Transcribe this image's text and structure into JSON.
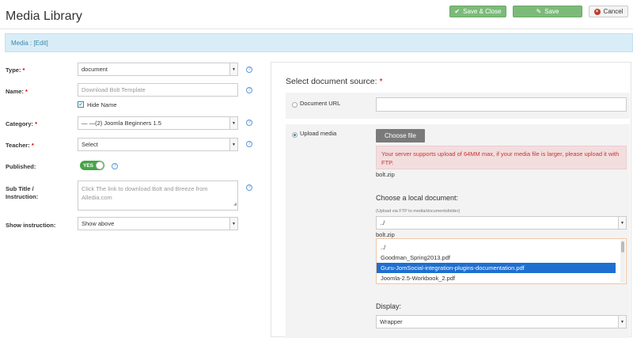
{
  "header": {
    "title": "Media Library",
    "save_close_label": "Save & Close",
    "save_label": "Save",
    "cancel_label": "Cancel"
  },
  "subbar": {
    "text": "Media : [Edit]"
  },
  "form": {
    "type": {
      "label": "Type:",
      "value": "document"
    },
    "name": {
      "label": "Name:",
      "placeholder": "Download Bolt Template"
    },
    "hide_name": {
      "label": "Hide Name",
      "checked": true
    },
    "category": {
      "label": "Category:",
      "value": "— —(2) Joomla Beginners 1.5"
    },
    "teacher": {
      "label": "Teacher:",
      "value": "Select"
    },
    "published": {
      "label": "Published:",
      "value": "YES"
    },
    "subtitle": {
      "label_line1": "Sub Title /",
      "label_line2": "Instruction:",
      "placeholder": "Click The link to download Bolt and Breeze from Alledia.com"
    },
    "show_instruction": {
      "label": "Show instruction:",
      "value": "Show above"
    },
    "required_mark": "*",
    "help_glyph": "?"
  },
  "source": {
    "title": "Select document source:",
    "required_mark": "*",
    "document_url_label": "Document URL",
    "upload_media_label": "Upload media",
    "choose_file_label": "Choose file",
    "alert_text": "Your server supports upload of 64MM max, if your media file is larger, please upload it with FTP.",
    "uploaded_file": "bolt.zip",
    "choose_local_label": "Choose a local document:",
    "ftp_hint": "(Upload via FTP to media/documentsfolder)",
    "folder_value": "../",
    "selected_file": "bolt.zip",
    "files": [
      {
        "name": "../",
        "selected": false
      },
      {
        "name": "Goodman_Spring2013.pdf",
        "selected": false
      },
      {
        "name": "Guru-JomSocial-integration-plugins-documentation.pdf",
        "selected": true
      },
      {
        "name": "Joomla-2.5-Workbook_2.pdf",
        "selected": false
      }
    ],
    "display_label": "Display:",
    "display_value": "Wrapper"
  },
  "colors": {
    "save_green": "#7cba7a",
    "info_bar": "#d9edf7",
    "toggle_green": "#46a546",
    "alert_text": "#cc3333",
    "list_selected": "#1e6fd0"
  },
  "icons": {
    "save_close": "check-icon",
    "save": "edit-icon",
    "cancel": "cancel-icon"
  }
}
